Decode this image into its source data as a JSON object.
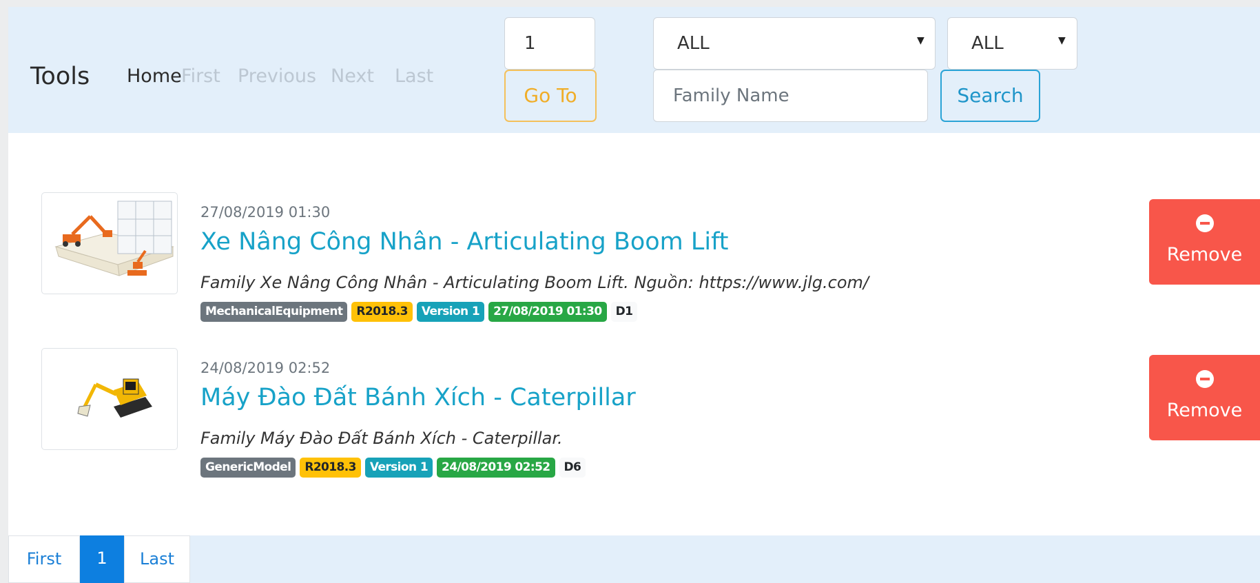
{
  "navbar": {
    "brand": "Tools",
    "links": {
      "home": "Home",
      "first": "First",
      "previous": "Previous",
      "next": "Next",
      "last": "Last"
    },
    "page_value": "1",
    "goto_label": "Go To",
    "category_select": "ALL",
    "version_select": "ALL",
    "family_placeholder": "Family Name",
    "search_label": "Search"
  },
  "items": [
    {
      "date": "27/08/2019 01:30",
      "title": "Xe Nâng Công Nhân - Articulating Boom Lift",
      "description": "Family Xe Nâng Công Nhân - Articulating Boom Lift. Nguồn: https://www.jlg.com/",
      "badges": [
        "MechanicalEquipment",
        "R2018.3",
        "Version 1",
        "27/08/2019 01:30",
        "D1"
      ],
      "remove_label": "Remove"
    },
    {
      "date": "24/08/2019 02:52",
      "title": "Máy Đào Đất Bánh Xích - Caterpillar",
      "description": "Family Máy Đào Đất Bánh Xích - Caterpillar.",
      "badges": [
        "GenericModel",
        "R2018.3",
        "Version 1",
        "24/08/2019 02:52",
        "D6"
      ],
      "remove_label": "Remove"
    }
  ],
  "pagination": {
    "first": "First",
    "current": "1",
    "last": "Last"
  },
  "colors": {
    "navbar_bg": "#e3effa",
    "title_link": "#17a2c8",
    "remove_button": "#f8564a",
    "goto_border": "#f4c05a",
    "search_border": "#2aa3d6",
    "page_active": "#0d7fe0"
  }
}
